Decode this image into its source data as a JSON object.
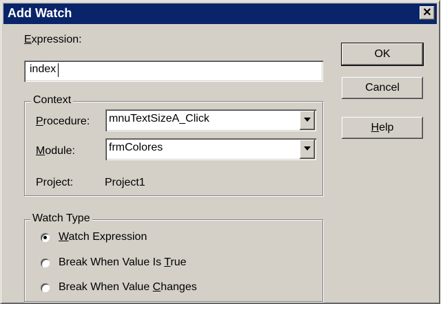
{
  "window": {
    "title": "Add Watch",
    "close_glyph": "✕"
  },
  "expression": {
    "label": "Expression:",
    "label_underline": "E",
    "label_rest": "xpression:",
    "value": "index"
  },
  "context": {
    "title": "Context",
    "procedure": {
      "label_underline": "P",
      "label_rest": "rocedure:",
      "value": "mnuTextSizeA_Click"
    },
    "module": {
      "label_underline": "M",
      "label_rest": "odule:",
      "value": "frmColores"
    },
    "project": {
      "label": "Project:",
      "value": "Project1"
    }
  },
  "watch_type": {
    "title": "Watch Type",
    "options": [
      {
        "pre": "",
        "ul": "W",
        "post": "atch Expression",
        "selected": true
      },
      {
        "pre": "Break When Value Is ",
        "ul": "T",
        "post": "rue",
        "selected": false
      },
      {
        "pre": "Break When Value ",
        "ul": "C",
        "post": "hanges",
        "selected": false
      }
    ]
  },
  "buttons": {
    "ok": "OK",
    "cancel": "Cancel",
    "help_ul": "H",
    "help_rest": "elp"
  },
  "icons": {
    "dropdown": "dropdown-arrow-icon",
    "close": "close-icon"
  }
}
